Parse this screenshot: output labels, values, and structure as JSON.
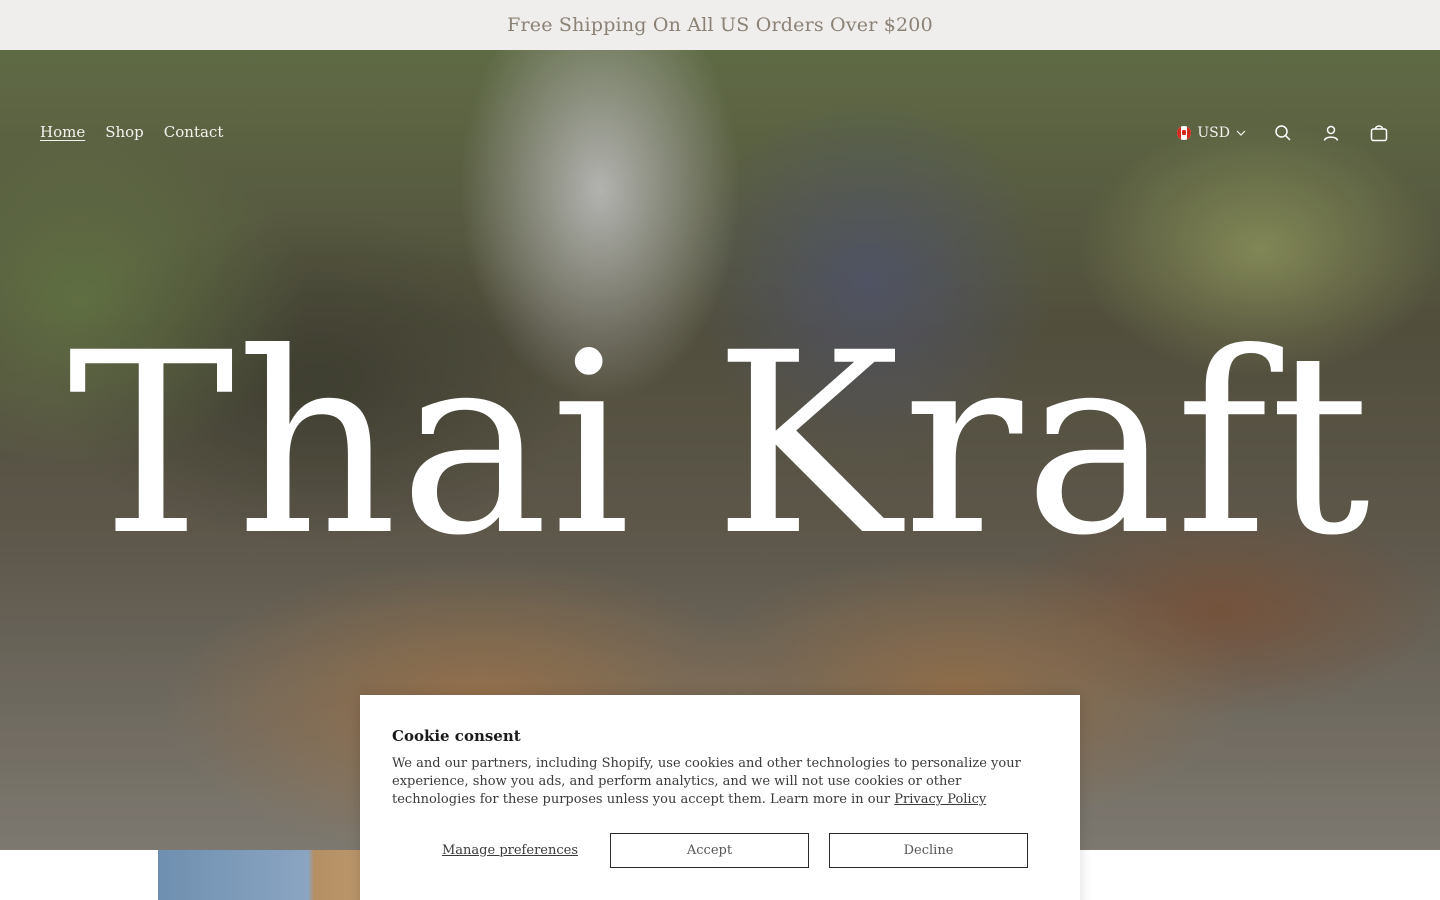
{
  "announcement": {
    "text": "Free Shipping On All US Orders Over $200"
  },
  "nav": {
    "items": [
      "Home",
      "Shop",
      "Contact"
    ]
  },
  "header": {
    "currency": "USD"
  },
  "hero": {
    "title": "Thai Kraft"
  },
  "cookie": {
    "title": "Cookie consent",
    "body": "We and our partners, including Shopify, use cookies and other technologies to personalize your experience, show you ads, and perform analytics, and we will not use cookies or other technologies for these purposes unless you accept them. Learn more in our ",
    "privacy_link": "Privacy Policy",
    "manage_label": "Manage preferences",
    "accept_label": "Accept",
    "decline_label": "Decline"
  },
  "icons": [
    "canada-flag-icon",
    "chevron-down-icon",
    "search-icon",
    "account-icon",
    "cart-icon"
  ]
}
